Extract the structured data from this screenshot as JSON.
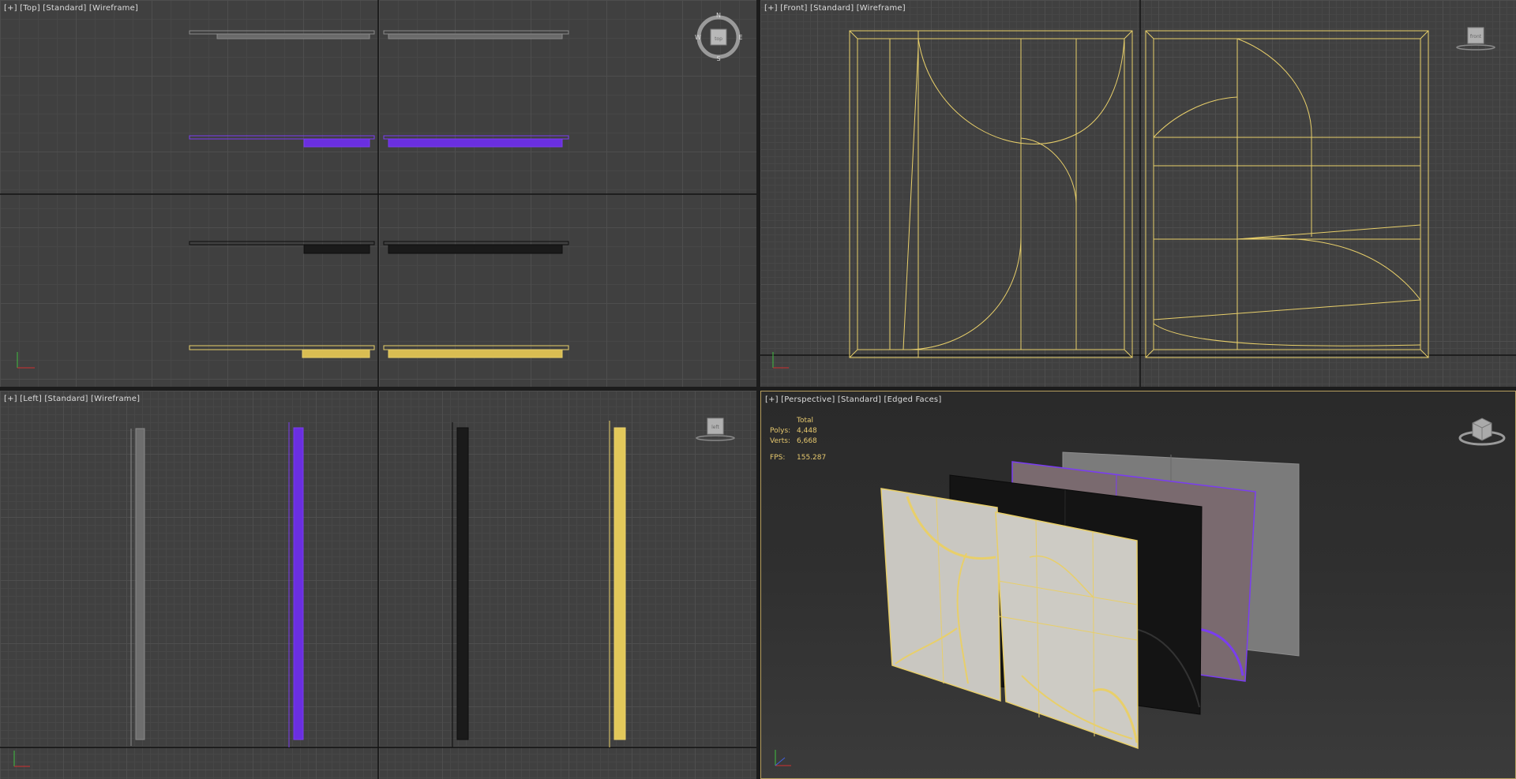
{
  "viewports": {
    "top": {
      "label": "[+] [Top] [Standard] [Wireframe]"
    },
    "front": {
      "label": "[+] [Front] [Standard] [Wireframe]"
    },
    "left": {
      "label": "[+] [Left] [Standard] [Wireframe]"
    },
    "perspective": {
      "label": "[+] [Perspective] [Standard] [Edged Faces]"
    }
  },
  "compass": {
    "n": "N",
    "s": "S",
    "e": "E",
    "w": "W",
    "cube_face": "top"
  },
  "viewcubes": {
    "left": "left",
    "front": "front"
  },
  "stats": {
    "header": "Total",
    "polys_label": "Polys:",
    "polys_value": "4,448",
    "verts_label": "Verts:",
    "verts_value": "6,668",
    "fps_label": "FPS:",
    "fps_value": "155.287"
  },
  "colors": {
    "viewport_bg": "#404040",
    "wire_grey": "#8a8a8a",
    "wire_purple": "#7a3df0",
    "wire_black": "#0d0d0d",
    "wire_yellow": "#e8cf6a",
    "active_border": "#b8a060",
    "stats_text": "#e6c86e"
  }
}
